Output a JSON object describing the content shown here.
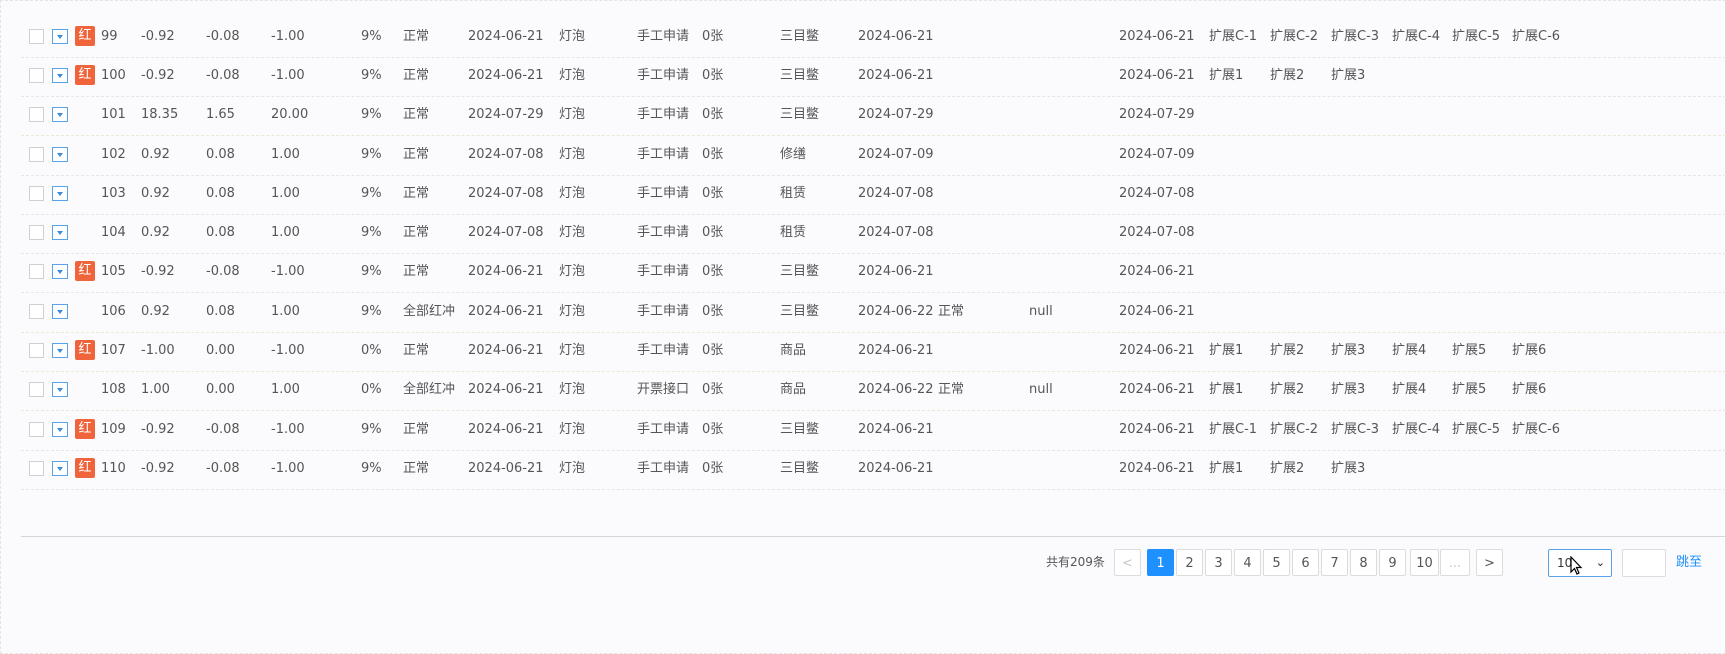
{
  "columns": [
    "id",
    "amount",
    "tax",
    "total",
    "rate",
    "status",
    "date1",
    "item",
    "source",
    "qty",
    "category",
    "date2",
    "state2",
    "note",
    "date3",
    "ext1",
    "ext2",
    "ext3",
    "ext4",
    "ext5",
    "ext6"
  ],
  "rows": [
    {
      "hong": true,
      "id": "99",
      "amount": "-0.92",
      "tax": "-0.08",
      "total": "-1.00",
      "rate": "9%",
      "status": "正常",
      "date1": "2024-06-21",
      "item": "灯泡",
      "source": "手工申请",
      "qty": "0张",
      "category": "三目鳖",
      "date2": "2024-06-21",
      "state2": "",
      "note": "",
      "date3": "2024-06-21",
      "ext1": "扩展C-1",
      "ext2": "扩展C-2",
      "ext3": "扩展C-3",
      "ext4": "扩展C-4",
      "ext5": "扩展C-5",
      "ext6": "扩展C-6"
    },
    {
      "hong": true,
      "id": "100",
      "amount": "-0.92",
      "tax": "-0.08",
      "total": "-1.00",
      "rate": "9%",
      "status": "正常",
      "date1": "2024-06-21",
      "item": "灯泡",
      "source": "手工申请",
      "qty": "0张",
      "category": "三目鳖",
      "date2": "2024-06-21",
      "state2": "",
      "note": "",
      "date3": "2024-06-21",
      "ext1": "扩展1",
      "ext2": "扩展2",
      "ext3": "扩展3",
      "ext4": "",
      "ext5": "",
      "ext6": ""
    },
    {
      "hong": false,
      "id": "101",
      "amount": "18.35",
      "tax": "1.65",
      "total": "20.00",
      "rate": "9%",
      "status": "正常",
      "date1": "2024-07-29",
      "item": "灯泡",
      "source": "手工申请",
      "qty": "0张",
      "category": "三目鳖",
      "date2": "2024-07-29",
      "state2": "",
      "note": "",
      "date3": "2024-07-29",
      "ext1": "",
      "ext2": "",
      "ext3": "",
      "ext4": "",
      "ext5": "",
      "ext6": ""
    },
    {
      "hong": false,
      "id": "102",
      "amount": "0.92",
      "tax": "0.08",
      "total": "1.00",
      "rate": "9%",
      "status": "正常",
      "date1": "2024-07-08",
      "item": "灯泡",
      "source": "手工申请",
      "qty": "0张",
      "category": "修缮",
      "date2": "2024-07-09",
      "state2": "",
      "note": "",
      "date3": "2024-07-09",
      "ext1": "",
      "ext2": "",
      "ext3": "",
      "ext4": "",
      "ext5": "",
      "ext6": ""
    },
    {
      "hong": false,
      "id": "103",
      "amount": "0.92",
      "tax": "0.08",
      "total": "1.00",
      "rate": "9%",
      "status": "正常",
      "date1": "2024-07-08",
      "item": "灯泡",
      "source": "手工申请",
      "qty": "0张",
      "category": "租赁",
      "date2": "2024-07-08",
      "state2": "",
      "note": "",
      "date3": "2024-07-08",
      "ext1": "",
      "ext2": "",
      "ext3": "",
      "ext4": "",
      "ext5": "",
      "ext6": ""
    },
    {
      "hong": false,
      "id": "104",
      "amount": "0.92",
      "tax": "0.08",
      "total": "1.00",
      "rate": "9%",
      "status": "正常",
      "date1": "2024-07-08",
      "item": "灯泡",
      "source": "手工申请",
      "qty": "0张",
      "category": "租赁",
      "date2": "2024-07-08",
      "state2": "",
      "note": "",
      "date3": "2024-07-08",
      "ext1": "",
      "ext2": "",
      "ext3": "",
      "ext4": "",
      "ext5": "",
      "ext6": ""
    },
    {
      "hong": true,
      "id": "105",
      "amount": "-0.92",
      "tax": "-0.08",
      "total": "-1.00",
      "rate": "9%",
      "status": "正常",
      "date1": "2024-06-21",
      "item": "灯泡",
      "source": "手工申请",
      "qty": "0张",
      "category": "三目鳖",
      "date2": "2024-06-21",
      "state2": "",
      "note": "",
      "date3": "2024-06-21",
      "ext1": "",
      "ext2": "",
      "ext3": "",
      "ext4": "",
      "ext5": "",
      "ext6": ""
    },
    {
      "hong": false,
      "id": "106",
      "amount": "0.92",
      "tax": "0.08",
      "total": "1.00",
      "rate": "9%",
      "status": "全部红冲",
      "date1": "2024-06-21",
      "item": "灯泡",
      "source": "手工申请",
      "qty": "0张",
      "category": "三目鳖",
      "date2": "2024-06-22",
      "state2": "正常",
      "note": "null",
      "date3": "2024-06-21",
      "ext1": "",
      "ext2": "",
      "ext3": "",
      "ext4": "",
      "ext5": "",
      "ext6": ""
    },
    {
      "hong": true,
      "id": "107",
      "amount": "-1.00",
      "tax": "0.00",
      "total": "-1.00",
      "rate": "0%",
      "status": "正常",
      "date1": "2024-06-21",
      "item": "灯泡",
      "source": "手工申请",
      "qty": "0张",
      "category": "商品",
      "date2": "2024-06-21",
      "state2": "",
      "note": "",
      "date3": "2024-06-21",
      "ext1": "扩展1",
      "ext2": "扩展2",
      "ext3": "扩展3",
      "ext4": "扩展4",
      "ext5": "扩展5",
      "ext6": "扩展6"
    },
    {
      "hong": false,
      "id": "108",
      "amount": "1.00",
      "tax": "0.00",
      "total": "1.00",
      "rate": "0%",
      "status": "全部红冲",
      "date1": "2024-06-21",
      "item": "灯泡",
      "source": "开票接口",
      "qty": "0张",
      "category": "商品",
      "date2": "2024-06-22",
      "state2": "正常",
      "note": "null",
      "date3": "2024-06-21",
      "ext1": "扩展1",
      "ext2": "扩展2",
      "ext3": "扩展3",
      "ext4": "扩展4",
      "ext5": "扩展5",
      "ext6": "扩展6"
    },
    {
      "hong": true,
      "id": "109",
      "amount": "-0.92",
      "tax": "-0.08",
      "total": "-1.00",
      "rate": "9%",
      "status": "正常",
      "date1": "2024-06-21",
      "item": "灯泡",
      "source": "手工申请",
      "qty": "0张",
      "category": "三目鳖",
      "date2": "2024-06-21",
      "state2": "",
      "note": "",
      "date3": "2024-06-21",
      "ext1": "扩展C-1",
      "ext2": "扩展C-2",
      "ext3": "扩展C-3",
      "ext4": "扩展C-4",
      "ext5": "扩展C-5",
      "ext6": "扩展C-6"
    },
    {
      "hong": true,
      "id": "110",
      "amount": "-0.92",
      "tax": "-0.08",
      "total": "-1.00",
      "rate": "9%",
      "status": "正常",
      "date1": "2024-06-21",
      "item": "灯泡",
      "source": "手工申请",
      "qty": "0张",
      "category": "三目鳖",
      "date2": "2024-06-21",
      "state2": "",
      "note": "",
      "date3": "2024-06-21",
      "ext1": "扩展1",
      "ext2": "扩展2",
      "ext3": "扩展3",
      "ext4": "",
      "ext5": "",
      "ext6": ""
    }
  ],
  "hong_label": "红",
  "pagination": {
    "total_text": "共有209条",
    "prev": "<",
    "next": ">",
    "pages": [
      "1",
      "2",
      "3",
      "4",
      "5",
      "6",
      "7",
      "8",
      "9",
      "10",
      "..."
    ],
    "current": "1",
    "page_size": "10",
    "jump_label": "跳至"
  },
  "colors": {
    "accent": "#1e90ff",
    "hong_badge": "#f0643c"
  }
}
